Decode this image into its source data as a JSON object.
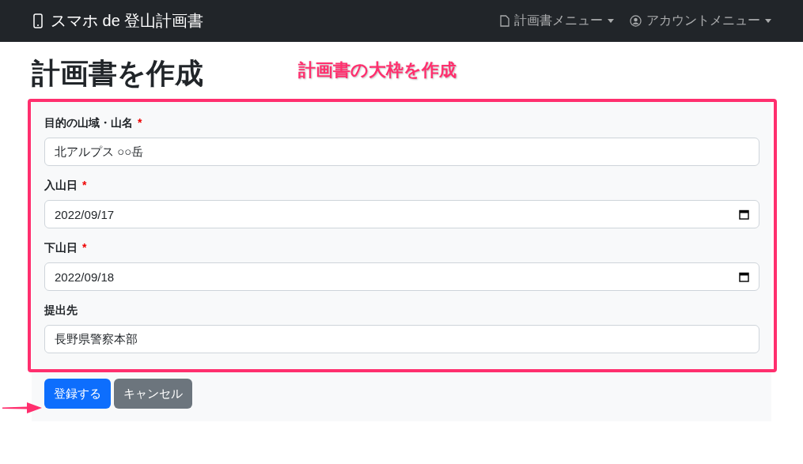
{
  "navbar": {
    "brand": "スマホ de 登山計画書",
    "menus": [
      {
        "kind": "document",
        "label": "計画書メニュー"
      },
      {
        "kind": "account",
        "label": "アカウントメニュー"
      }
    ]
  },
  "page": {
    "title": "計画書を作成",
    "annotation": "計画書の大枠を作成"
  },
  "form": {
    "fields": [
      {
        "kind": "text",
        "label": "目的の山域・山名",
        "required_mark": "*",
        "value": "北アルプス ○○岳"
      },
      {
        "kind": "date",
        "label": "入山日",
        "required_mark": "*",
        "value": "2022/09/17"
      },
      {
        "kind": "date",
        "label": "下山日",
        "required_mark": "*",
        "value": "2022/09/18"
      },
      {
        "kind": "text",
        "label": "提出先",
        "value": "長野県警察本部"
      }
    ],
    "buttons": [
      {
        "kind": "primary",
        "label": "登録する"
      },
      {
        "kind": "secondary",
        "label": "キャンセル"
      }
    ]
  }
}
